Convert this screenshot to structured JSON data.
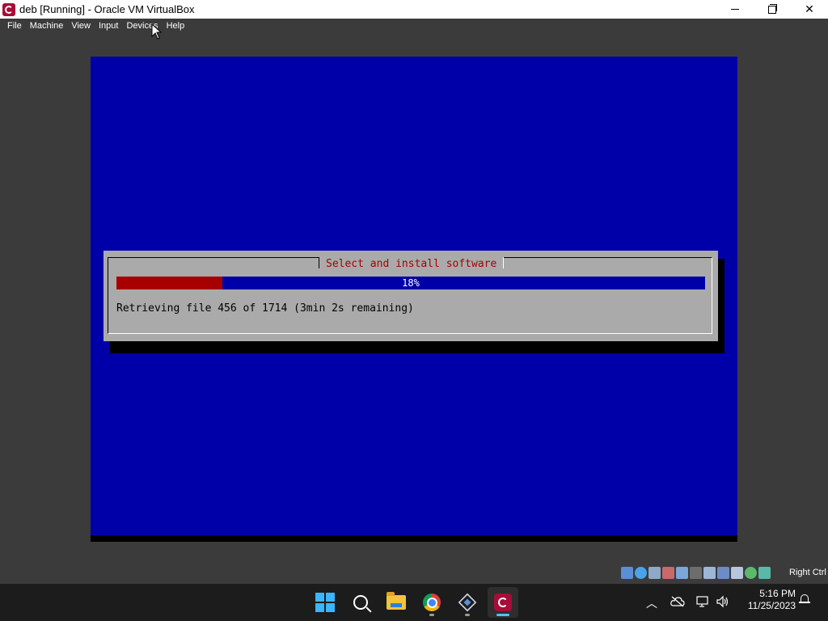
{
  "window": {
    "title": "deb [Running] - Oracle VM VirtualBox"
  },
  "menu": {
    "items": [
      "File",
      "Machine",
      "View",
      "Input",
      "Devices",
      "Help"
    ]
  },
  "installer": {
    "dialog_title": "Select and install software",
    "progress_percent": 18,
    "progress_label": "18%",
    "status": "Retrieving file 456 of 1714 (3min 2s remaining)"
  },
  "statusbar": {
    "host_key": "Right Ctrl",
    "icons": [
      "hard-disk-icon",
      "optical-drive-icon",
      "audio-icon",
      "network-icon",
      "usb-icon",
      "shared-folders-icon",
      "display-icon",
      "video-capture-icon",
      "virtualization-icon",
      "guest-additions-icon",
      "mouse-integration-icon"
    ]
  },
  "taskbar": {
    "apps": [
      "start-icon",
      "search-icon",
      "file-explorer-icon",
      "chrome-icon",
      "virtualbox-icon",
      "debian-vm-icon"
    ],
    "time": "5:16 PM",
    "date": "11/25/2023"
  },
  "colors": {
    "vm_background": "#0000a8",
    "dialog_gray": "#aaaaaa",
    "dialog_title_red": "#a80000",
    "progress_fill": "#a80000",
    "titlebar": "#ffffff",
    "vbox_chrome": "#3b3b3b",
    "taskbar": "#1c1c1c"
  }
}
